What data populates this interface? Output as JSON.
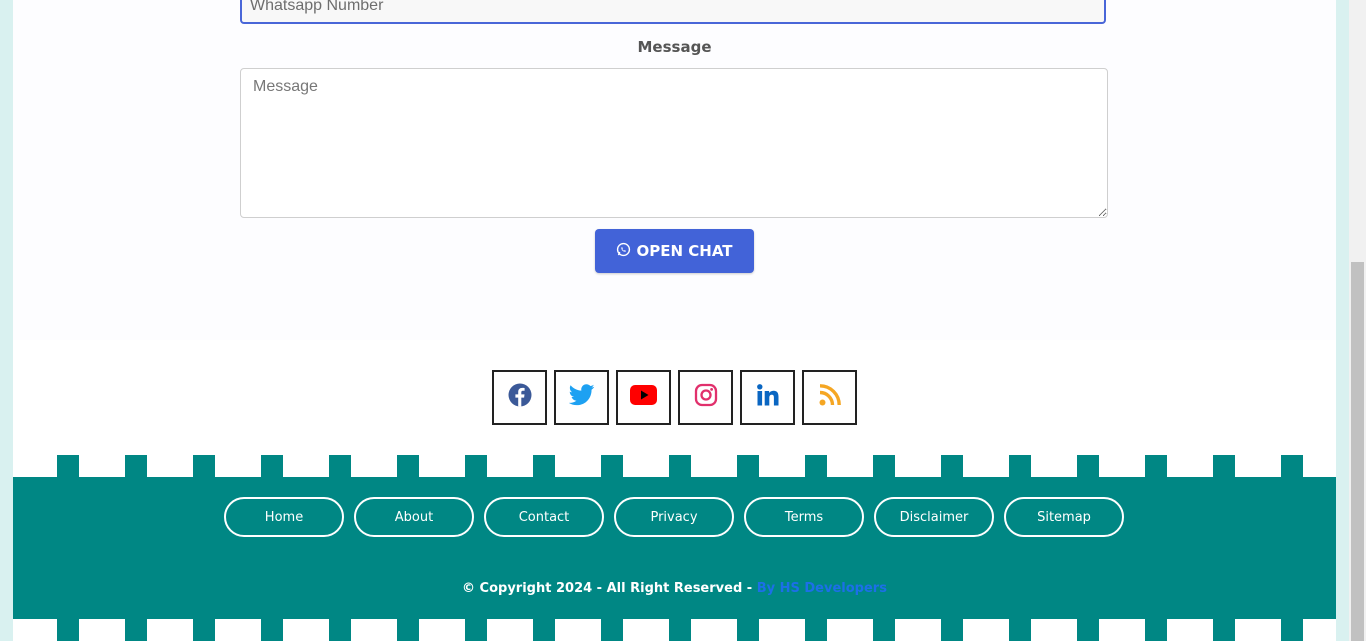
{
  "form": {
    "whatsapp_placeholder": "Whatsapp Number",
    "message_label": "Message",
    "message_placeholder": "Message",
    "open_chat_label": "OPEN CHAT",
    "button_color": "#4263d8"
  },
  "social": [
    {
      "name": "facebook",
      "icon": "facebook-icon",
      "color": "#3b5998"
    },
    {
      "name": "twitter",
      "icon": "twitter-icon",
      "color": "#1da1f2"
    },
    {
      "name": "youtube",
      "icon": "youtube-icon",
      "color": "#ff0000"
    },
    {
      "name": "instagram",
      "icon": "instagram-icon",
      "color": "#e1306c"
    },
    {
      "name": "linkedin",
      "icon": "linkedin-icon",
      "color": "#0a66c2"
    },
    {
      "name": "rss",
      "icon": "rss-icon",
      "color": "#f5a623"
    }
  ],
  "footer": {
    "background": "#008784",
    "nav": [
      "Home",
      "About",
      "Contact",
      "Privacy",
      "Terms",
      "Disclaimer",
      "Sitemap"
    ],
    "copyright_text": "© Copyright 2024 - All Right Reserved - ",
    "copyright_brand": "By HS Developers",
    "brand_color": "#1c6fe8"
  }
}
